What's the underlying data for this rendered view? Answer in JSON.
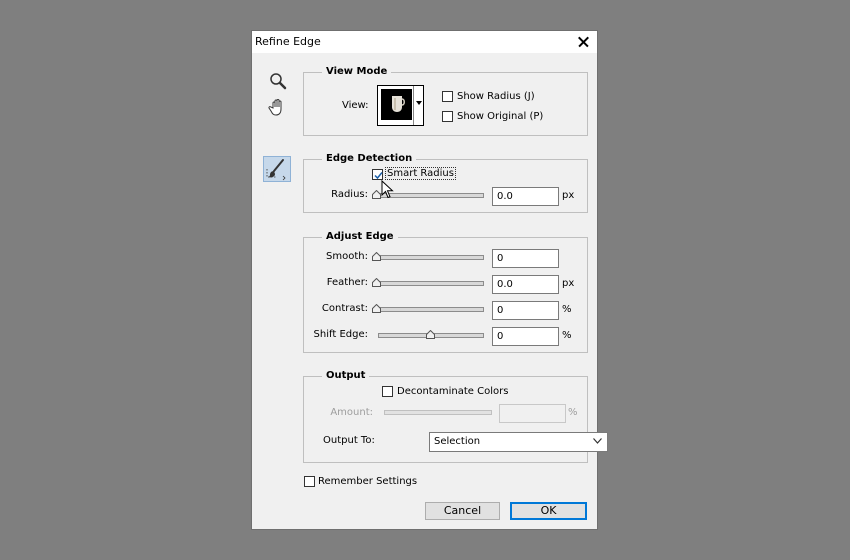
{
  "dialog": {
    "title": "Refine Edge"
  },
  "tools": [
    "zoom-tool",
    "hand-tool",
    "refine-radius-brush"
  ],
  "view_mode": {
    "title": "View Mode",
    "view_label": "View:",
    "show_radius_label": "Show Radius (J)",
    "show_radius_checked": false,
    "show_original_label": "Show Original (P)",
    "show_original_checked": false
  },
  "edge_detection": {
    "title": "Edge Detection",
    "smart_radius_label": "Smart Radius",
    "smart_radius_checked": true,
    "radius_label": "Radius:",
    "radius_value": "0.0",
    "radius_unit": "px"
  },
  "adjust_edge": {
    "title": "Adjust Edge",
    "smooth_label": "Smooth:",
    "smooth_value": "0",
    "feather_label": "Feather:",
    "feather_value": "0.0",
    "feather_unit": "px",
    "contrast_label": "Contrast:",
    "contrast_value": "0",
    "contrast_unit": "%",
    "shift_edge_label": "Shift Edge:",
    "shift_edge_value": "0",
    "shift_edge_unit": "%"
  },
  "output": {
    "title": "Output",
    "decontaminate_label": "Decontaminate Colors",
    "decontaminate_checked": false,
    "amount_label": "Amount:",
    "amount_value": "",
    "amount_unit": "%",
    "output_to_label": "Output To:",
    "output_to_value": "Selection"
  },
  "remember_settings_label": "Remember Settings",
  "remember_settings_checked": false,
  "buttons": {
    "cancel": "Cancel",
    "ok": "OK"
  },
  "colors": {
    "background": "#7f7f7f",
    "dialog": "#f0f0f0",
    "primary_border": "#0078d7",
    "brush_highlight": "#c6d8ea"
  }
}
